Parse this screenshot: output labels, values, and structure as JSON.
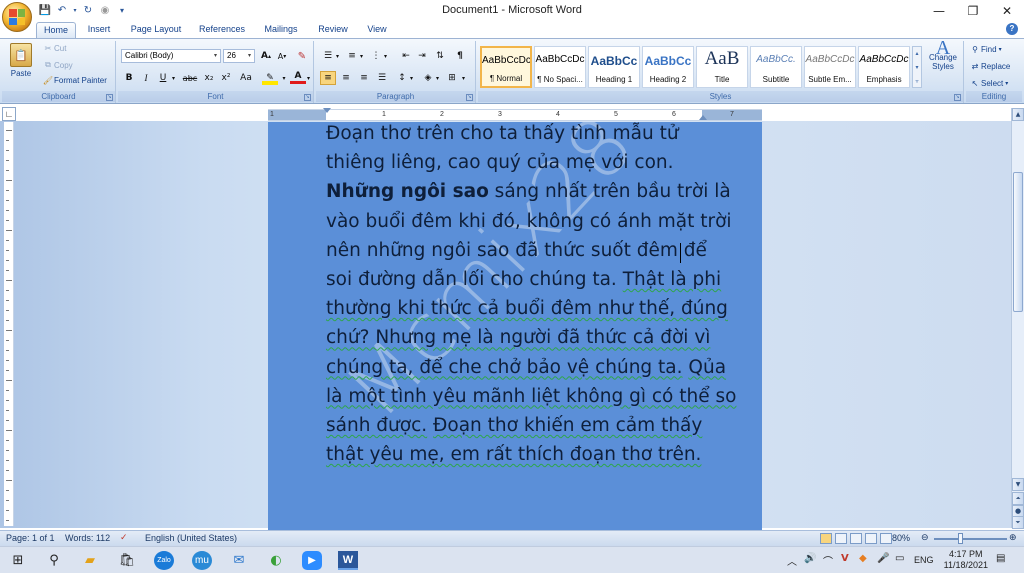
{
  "window": {
    "title": "Document1 - Microsoft Word",
    "controls": {
      "minimize": "—",
      "maximize": "❐",
      "close": "✕"
    }
  },
  "quick_access": {
    "save_icon": "save-icon",
    "undo_icon": "undo-icon",
    "redo_icon": "redo-icon"
  },
  "tabs": [
    "Home",
    "Insert",
    "Page Layout",
    "References",
    "Mailings",
    "Review",
    "View"
  ],
  "active_tab": "Home",
  "ribbon": {
    "clipboard": {
      "label": "Clipboard",
      "paste": "Paste",
      "cut": "Cut",
      "copy": "Copy",
      "format_painter": "Format Painter"
    },
    "font": {
      "label": "Font",
      "font_name": "Calibri (Body)",
      "font_size": "26",
      "grow": "A",
      "shrink": "A",
      "bold": "B",
      "italic": "I",
      "underline": "U",
      "strike": "abc",
      "subscript": "x₂",
      "superscript": "x²",
      "change_case": "Aa",
      "font_color": "A"
    },
    "paragraph": {
      "label": "Paragraph"
    },
    "styles": {
      "label": "Styles",
      "items": [
        {
          "preview": "AaBbCcDc",
          "name": "¶ Normal"
        },
        {
          "preview": "AaBbCcDc",
          "name": "¶ No Spaci..."
        },
        {
          "preview": "AaBbCc",
          "name": "Heading 1"
        },
        {
          "preview": "AaBbCc",
          "name": "Heading 2"
        },
        {
          "preview": "AaB",
          "name": "Title"
        },
        {
          "preview": "AaBbCc.",
          "name": "Subtitle"
        },
        {
          "preview": "AaBbCcDc",
          "name": "Subtle Em..."
        },
        {
          "preview": "AaBbCcDc",
          "name": "Emphasis"
        }
      ],
      "change_styles": "Change Styles"
    },
    "editing": {
      "label": "Editing",
      "find": "Find",
      "replace": "Replace",
      "select": "Select"
    }
  },
  "ruler": {
    "numbers": [
      "1",
      "1",
      "2",
      "3",
      "4",
      "5",
      "6",
      "7"
    ]
  },
  "document": {
    "lines": [
      [
        {
          "t": "Đoạn thơ trên cho ta thấy tình mẫu tử"
        }
      ],
      [
        {
          "t": "thiêng liêng, cao quý của mẹ với con."
        }
      ],
      [
        {
          "t": "Những ngôi sao",
          "b": true
        },
        {
          "t": " sáng nhất trên bầu trời là"
        }
      ],
      [
        {
          "t": "vào buổi đêm khi đó, không có ánh mặt trời"
        }
      ],
      [
        {
          "t": "nên những ngôi sao đã thức suốt đêm để"
        }
      ],
      [
        {
          "t": "soi đường dẫn lối cho chúng ta. "
        },
        {
          "t": "Thật là phi",
          "sq": true
        }
      ],
      [
        {
          "t": "thường khi thức cả buổi đêm như thế, đúng",
          "sq": true
        }
      ],
      [
        {
          "t": "chứ? ",
          "sq": true
        },
        {
          "t": "Nhưng mẹ là người đã thức cả đời vì",
          "sq": true
        }
      ],
      [
        {
          "t": "chúng ta, để che chở bảo vệ chúng ta.",
          "sq": true
        },
        {
          "t": " "
        },
        {
          "t": "Qủa",
          "sq": true
        }
      ],
      [
        {
          "t": "là một tình yêu mãnh liệt không gì có thể so",
          "sq": true
        }
      ],
      [
        {
          "t": "sánh được.",
          "sq": true
        },
        {
          "t": " "
        },
        {
          "t": "Đoạn thơ khiến em cảm thấy",
          "sq": true
        }
      ],
      [
        {
          "t": "thật yêu mẹ, em rất thích đoạn thơ trên.",
          "sq": true
        }
      ]
    ],
    "watermark": "Mcmix28"
  },
  "status": {
    "page": "Page: 1 of 1",
    "words": "Words: 112",
    "language": "English (United States)",
    "zoom": "80%",
    "zoom_value": 0.8
  },
  "taskbar": {
    "apps": [
      "windows-icon",
      "search-icon",
      "file-explorer-icon",
      "store-icon",
      "zalo-icon",
      "mu-icon",
      "mail-icon",
      "cốc-cốc-icon",
      "zoom-icon",
      "word-icon"
    ],
    "zalo_label": "Zalo",
    "mu_label": "mu",
    "tray_language": "ENG",
    "time": "4:17 PM",
    "date": "11/18/2021"
  },
  "colors": {
    "page_background": "#5b8fd8",
    "ribbon_gradient_top": "#f4f8fd",
    "squiggle": "#2ea64a",
    "accent": "#15428b"
  }
}
